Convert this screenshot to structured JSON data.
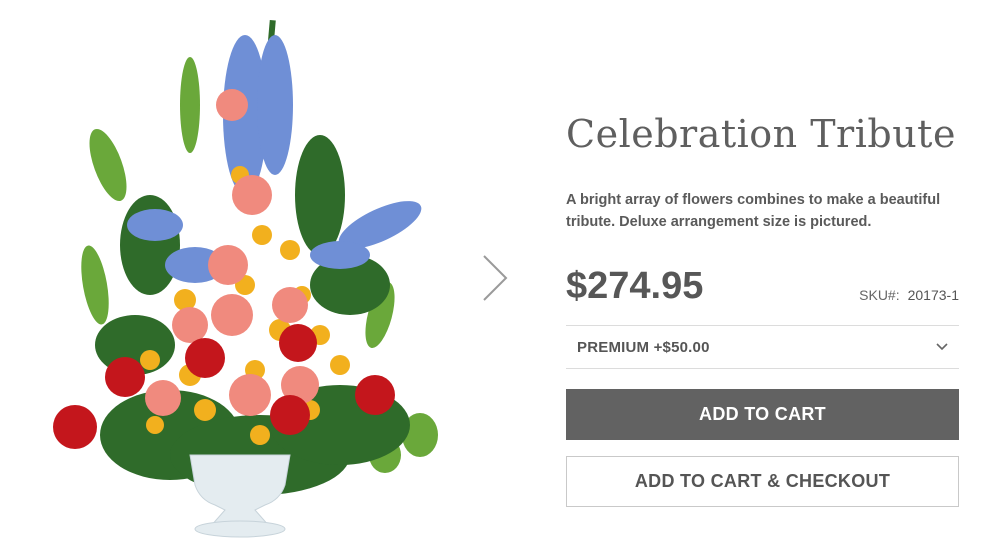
{
  "product": {
    "image_alt": "Celebration Tribute floral arrangement in white pedestal urn",
    "title": "Celebration Tribute",
    "description": "A bright array of flowers combines to make a beautiful tribute. Deluxe arrangement size is pictured.",
    "price": "$274.95",
    "sku_label": "SKU#:",
    "sku_value": "20173-1"
  },
  "options": {
    "selected": "PREMIUM +$50.00"
  },
  "buttons": {
    "add_to_cart": "ADD TO CART",
    "add_to_cart_checkout": "ADD TO CART & CHECKOUT"
  },
  "icons": {
    "next": "chevron-right-icon",
    "dropdown": "chevron-down-icon"
  },
  "colors": {
    "primary_button": "#626262",
    "text": "#555555",
    "border": "#c9c9c9"
  }
}
